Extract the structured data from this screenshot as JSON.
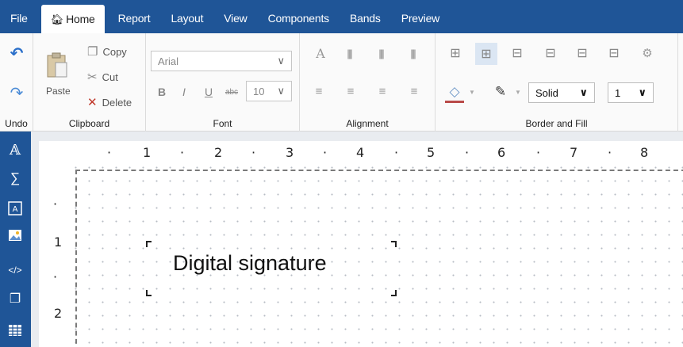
{
  "menu": {
    "items": [
      {
        "label": "File"
      },
      {
        "label": "Home",
        "icon": "home-icon",
        "active": true
      },
      {
        "label": "Report"
      },
      {
        "label": "Layout"
      },
      {
        "label": "View"
      },
      {
        "label": "Components"
      },
      {
        "label": "Bands"
      },
      {
        "label": "Preview"
      }
    ]
  },
  "ribbon": {
    "undo": {
      "group_label": "Undo",
      "undo_icon": "undo-icon",
      "redo_icon": "redo-icon"
    },
    "clipboard": {
      "group_label": "Clipboard",
      "paste_label": "Paste",
      "copy_label": "Copy",
      "cut_label": "Cut",
      "delete_label": "Delete"
    },
    "font": {
      "group_label": "Font",
      "font_name": "Arial",
      "font_size": "10",
      "bold_label": "B",
      "italic_label": "I",
      "underline_label": "U",
      "strike_label": "abc"
    },
    "alignment": {
      "group_label": "Alignment"
    },
    "border_fill": {
      "group_label": "Border and Fill",
      "line_style": "Solid",
      "line_width": "1"
    }
  },
  "toolbox": {
    "tools": [
      "text-icon",
      "sum-icon",
      "text-field-icon",
      "picture-icon",
      "html-icon",
      "copy-page-icon",
      "table-icon"
    ]
  },
  "ruler": {
    "top": [
      "·",
      "1",
      "·",
      "2",
      "·",
      "3",
      "·",
      "4",
      "·",
      "5",
      "·",
      "6",
      "·",
      "7",
      "·",
      "8"
    ],
    "left": [
      "·",
      "1",
      "·",
      "2"
    ]
  },
  "canvas": {
    "signature_text": "Digital signature"
  },
  "colors": {
    "brand": "#1f5597",
    "ribbon_bg": "#fafafa",
    "canvas_bg": "#e9ecf0",
    "fill_underline": "#b94a48"
  }
}
